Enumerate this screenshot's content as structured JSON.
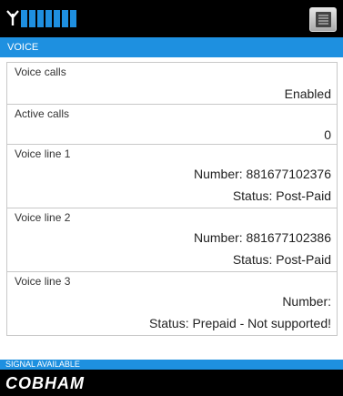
{
  "header": {
    "signal_bars": 7,
    "accent_color": "#1e90e0",
    "antenna_icon": "antenna-icon",
    "menu_icon": "menu-list-icon"
  },
  "section": {
    "title": "VOICE"
  },
  "voice_calls": {
    "label": "Voice calls",
    "value": "Enabled"
  },
  "active_calls": {
    "label": "Active calls",
    "value": "0"
  },
  "voice_lines": [
    {
      "label": "Voice line 1",
      "number": "Number: 881677102376",
      "status": "Status: Post-Paid"
    },
    {
      "label": "Voice line 2",
      "number": "Number: 881677102386",
      "status": "Status: Post-Paid"
    },
    {
      "label": "Voice line 3",
      "number": "Number:",
      "status": "Status: Prepaid - Not supported!"
    }
  ],
  "footer": {
    "signal_text": "SIGNAL AVAILABLE",
    "brand": "COBHAM"
  }
}
